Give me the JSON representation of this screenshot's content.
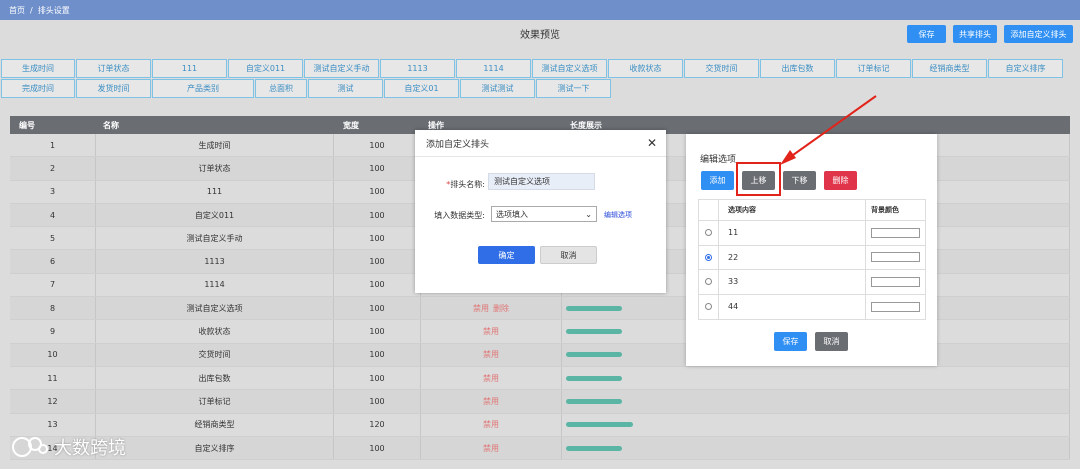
{
  "breadcrumb": {
    "home": "首页",
    "separator": "/",
    "current": "排头设置"
  },
  "toolbar": {
    "preview_title": "效果预览",
    "save": "保存",
    "share": "共享排头",
    "add_custom": "添加自定义排头"
  },
  "tags_row1": [
    "生成时间",
    "订单状态",
    "111",
    "自定义011",
    "测试自定义手动",
    "1113",
    "1114",
    "测试自定义选项",
    "收款状态",
    "交货时间",
    "出库包数",
    "订单标记",
    "经销商类型",
    "自定义排序"
  ],
  "tags_row2": [
    "完成时间",
    "发货时间",
    "产品类别",
    "总面积",
    "测试",
    "自定义01",
    "测试测试",
    "测试一下"
  ],
  "table": {
    "headers": {
      "no": "编号",
      "name": "名称",
      "width": "宽度",
      "op": "操作",
      "length": "长度展示"
    },
    "rows": [
      {
        "no": "1",
        "name": "生成时间",
        "width": "100",
        "op": [],
        "bar": 0
      },
      {
        "no": "2",
        "name": "订单状态",
        "width": "100",
        "op": [],
        "bar": 0
      },
      {
        "no": "3",
        "name": "111",
        "width": "100",
        "op": [],
        "bar": 0
      },
      {
        "no": "4",
        "name": "自定义011",
        "width": "100",
        "op": [],
        "bar": 0
      },
      {
        "no": "5",
        "name": "测试自定义手动",
        "width": "100",
        "op": [],
        "bar": 0
      },
      {
        "no": "6",
        "name": "1113",
        "width": "100",
        "op": [],
        "bar": 0
      },
      {
        "no": "7",
        "name": "1114",
        "width": "100",
        "op": [],
        "bar": 0
      },
      {
        "no": "8",
        "name": "测试自定义选项",
        "width": "100",
        "op": [
          "禁用",
          "删除"
        ],
        "bar": 100
      },
      {
        "no": "9",
        "name": "收款状态",
        "width": "100",
        "op": [
          "禁用"
        ],
        "bar": 100
      },
      {
        "no": "10",
        "name": "交货时间",
        "width": "100",
        "op": [
          "禁用"
        ],
        "bar": 100
      },
      {
        "no": "11",
        "name": "出库包数",
        "width": "100",
        "op": [
          "禁用"
        ],
        "bar": 100
      },
      {
        "no": "12",
        "name": "订单标记",
        "width": "100",
        "op": [
          "禁用"
        ],
        "bar": 100
      },
      {
        "no": "13",
        "name": "经销商类型",
        "width": "120",
        "op": [
          "禁用"
        ],
        "bar": 120
      },
      {
        "no": "14",
        "name": "自定义排序",
        "width": "100",
        "op": [
          "禁用"
        ],
        "bar": 100
      }
    ]
  },
  "add_dialog": {
    "title": "添加自定义排头",
    "name_required_mark": "*",
    "name_label": "排头名称:",
    "name_value": "测试自定义选项",
    "type_label": "填入数据类型:",
    "type_value": "选项填入",
    "edit_options_link": "编辑选项",
    "confirm": "确定",
    "cancel": "取消"
  },
  "options_panel": {
    "title": "编辑选项",
    "add": "添加",
    "move_up": "上移",
    "move_down": "下移",
    "delete": "删除",
    "col_content": "选项内容",
    "col_color": "背景颜色",
    "options": [
      {
        "value": "11",
        "selected": false
      },
      {
        "value": "22",
        "selected": true
      },
      {
        "value": "33",
        "selected": false
      },
      {
        "value": "44",
        "selected": false
      }
    ],
    "save": "保存",
    "cancel": "取消"
  },
  "colors": {
    "primary": "#2f8ff2",
    "danger": "#e0344b",
    "gray_button": "#6a6e73",
    "annotation": "#e2231a",
    "bar": "#5ab5a4"
  },
  "watermark": {
    "text": "大数跨境"
  }
}
